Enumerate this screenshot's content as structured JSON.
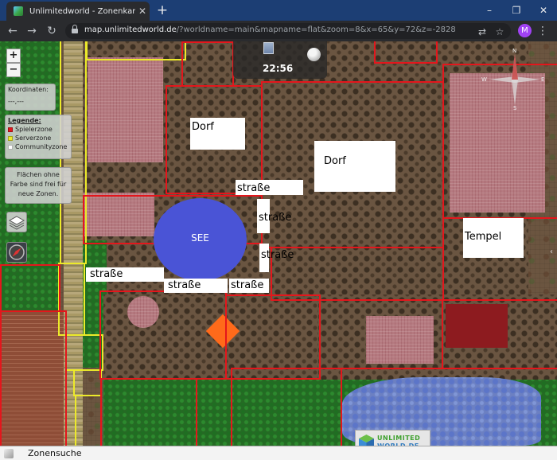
{
  "browser": {
    "tab_title": "Unlimitedworld - Zonenkarte",
    "tab_close": "✕",
    "new_tab": "+",
    "url_host": "map.unlimitedworld.de",
    "url_path": "/?worldname=main&mapname=flat&zoom=8&x=65&y=72&z=-2828",
    "avatar_initial": "M",
    "window_minimize": "–",
    "window_restore": "❐",
    "window_close": "✕"
  },
  "map": {
    "zoom_in": "+",
    "zoom_out": "−",
    "coords_title": "Koordinaten:",
    "coords_value": "---,---",
    "legend_title": "Legende:",
    "legend": [
      {
        "label": "Spielerzone",
        "color": "#e4161c"
      },
      {
        "label": "Serverzone",
        "color": "#ecea2a"
      },
      {
        "label": "Communityzone",
        "color": "#ffffff"
      }
    ],
    "info_text": "Flächen ohne Farbe sind frei für neue Zonen.",
    "time": "22:56",
    "compass": {
      "n": "N",
      "e": "E",
      "s": "S",
      "w": "W"
    },
    "labels": {
      "dorf1": "Dorf",
      "dorf2": "Dorf",
      "strasse1": "straße",
      "strasse2": "straße",
      "strasse3": "straße",
      "strasse4": "straße",
      "strasse5": "straße",
      "strasse6": "straße",
      "see": "SEE",
      "tempel": "Tempel"
    },
    "logo_line1": "UNLIMITED",
    "logo_line2": "WORLD.DE",
    "zone_search": "Zonensuche"
  }
}
